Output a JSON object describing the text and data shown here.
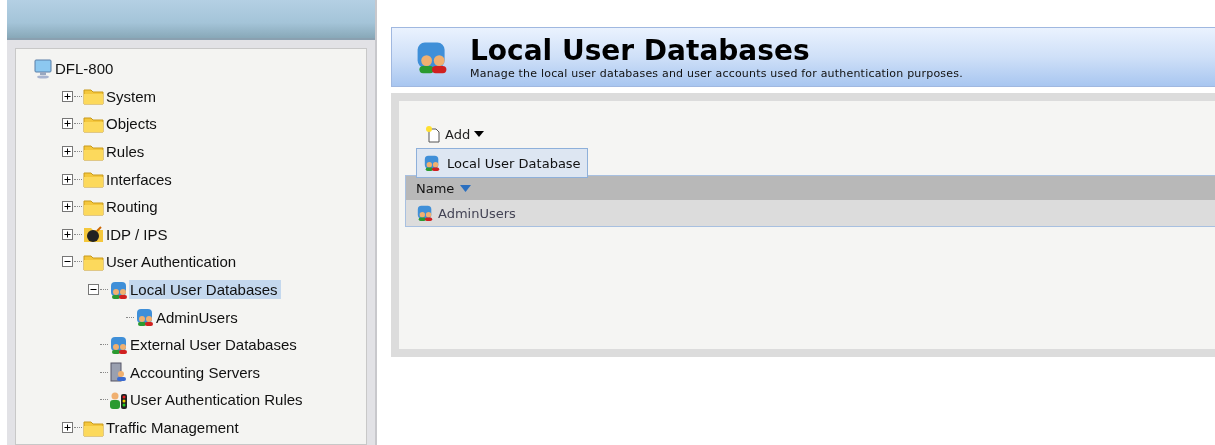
{
  "tree": {
    "label": "DFL-800",
    "kind": "computer",
    "selected": false,
    "children": [
      {
        "label": "System",
        "kind": "folder",
        "expanded": false,
        "selected": false
      },
      {
        "label": "Objects",
        "kind": "folder",
        "expanded": false,
        "selected": false
      },
      {
        "label": "Rules",
        "kind": "folder",
        "expanded": false,
        "selected": false
      },
      {
        "label": "Interfaces",
        "kind": "folder",
        "expanded": false,
        "selected": false
      },
      {
        "label": "Routing",
        "kind": "folder",
        "expanded": false,
        "selected": false
      },
      {
        "label": "IDP / IPS",
        "kind": "bomb",
        "expanded": false,
        "selected": false
      },
      {
        "label": "User Authentication",
        "kind": "folder",
        "expanded": true,
        "selected": false,
        "children": [
          {
            "label": "Local User Databases",
            "kind": "database",
            "expanded": true,
            "selected": true,
            "children": [
              {
                "label": "AdminUsers",
                "kind": "database",
                "selected": false
              }
            ]
          },
          {
            "label": "External User Databases",
            "kind": "database",
            "selected": false
          },
          {
            "label": "Accounting Servers",
            "kind": "server",
            "selected": false
          },
          {
            "label": "User Authentication Rules",
            "kind": "users",
            "selected": false
          }
        ]
      },
      {
        "label": "Traffic Management",
        "kind": "folder",
        "expanded": false,
        "selected": false
      }
    ]
  },
  "page": {
    "title": "Local User Databases",
    "subtitle": "Manage the local user databases and user accounts used for authentication purposes."
  },
  "toolbar": {
    "add_button": "Add",
    "menu_items": [
      "Local User Database"
    ]
  },
  "table": {
    "columns": [
      "Name"
    ],
    "rows": [
      {
        "name": "AdminUsers"
      }
    ]
  }
}
